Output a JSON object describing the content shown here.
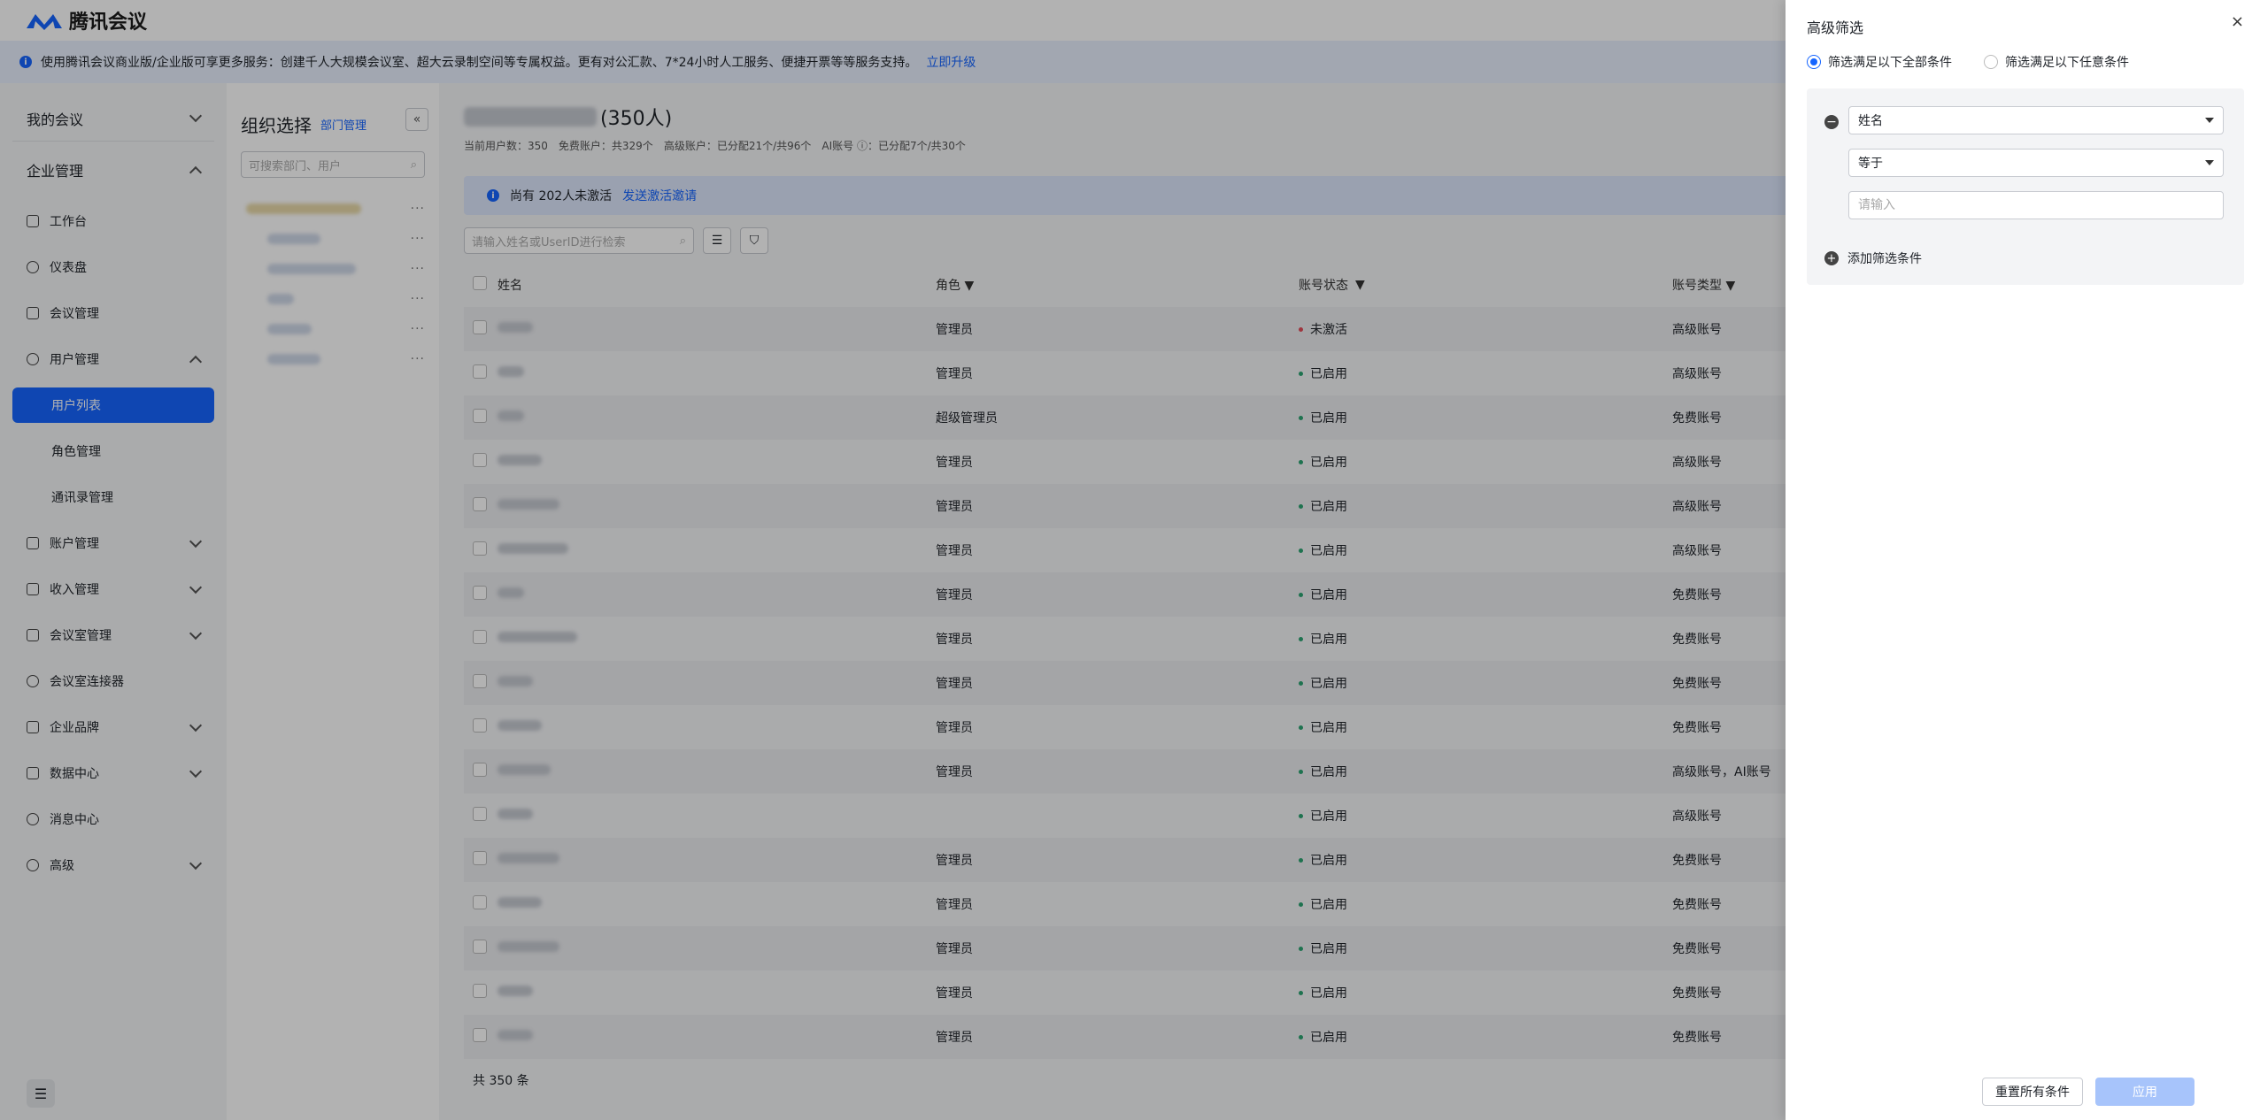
{
  "app": {
    "name": "腾讯会议"
  },
  "banner": {
    "text": "使用腾讯会议商业版/企业版可享更多服务：创建千人大规模会议室、超大云录制空间等专属权益。更有对公汇款、7*24小时人工服务、便捷开票等等服务支持。",
    "link": "立即升级"
  },
  "sidebar": {
    "sections": [
      "我的会议",
      "企业管理"
    ],
    "items": [
      {
        "label": "工作台"
      },
      {
        "label": "仪表盘"
      },
      {
        "label": "会议管理"
      },
      {
        "label": "用户管理"
      },
      {
        "label": "用户列表"
      },
      {
        "label": "角色管理"
      },
      {
        "label": "通讯录管理"
      },
      {
        "label": "账户管理"
      },
      {
        "label": "收入管理"
      },
      {
        "label": "会议室管理"
      },
      {
        "label": "会议室连接器"
      },
      {
        "label": "企业品牌"
      },
      {
        "label": "数据中心"
      },
      {
        "label": "消息中心"
      },
      {
        "label": "高级"
      }
    ]
  },
  "org": {
    "title": "组织选择",
    "manage": "部门管理",
    "search_placeholder": "可搜索部门、用户"
  },
  "main": {
    "count_label": "(350人)",
    "stats": [
      "当前用户数：350",
      "免费账户：共329个",
      "高级账户：已分配21个/共96个",
      "AI账号 ⓘ：已分配7个/共30个"
    ],
    "notice": "尚有 202人未激活",
    "notice_link": "发送激活邀请",
    "search_placeholder": "请输入姓名或UserID进行检索",
    "columns": [
      "姓名",
      "角色",
      "账号状态",
      "账号类型"
    ],
    "rows": [
      {
        "role": "管理员",
        "status": "未激活",
        "type": "高级账号"
      },
      {
        "role": "管理员",
        "status": "已启用",
        "type": "高级账号"
      },
      {
        "role": "超级管理员",
        "status": "已启用",
        "type": "免费账号"
      },
      {
        "role": "管理员",
        "status": "已启用",
        "type": "高级账号"
      },
      {
        "role": "管理员",
        "status": "已启用",
        "type": "高级账号"
      },
      {
        "role": "管理员",
        "status": "已启用",
        "type": "高级账号"
      },
      {
        "role": "管理员",
        "status": "已启用",
        "type": "免费账号"
      },
      {
        "role": "管理员",
        "status": "已启用",
        "type": "免费账号"
      },
      {
        "role": "管理员",
        "status": "已启用",
        "type": "免费账号"
      },
      {
        "role": "管理员",
        "status": "已启用",
        "type": "免费账号"
      },
      {
        "role": "管理员",
        "status": "已启用",
        "type": "高级账号，AI账号"
      },
      {
        "role": "",
        "status": "已启用",
        "type": "高级账号"
      },
      {
        "role": "管理员",
        "status": "已启用",
        "type": "免费账号"
      },
      {
        "role": "管理员",
        "status": "已启用",
        "type": "免费账号"
      },
      {
        "role": "管理员",
        "status": "已启用",
        "type": "免费账号"
      },
      {
        "role": "管理员",
        "status": "已启用",
        "type": "免费账号"
      },
      {
        "role": "管理员",
        "status": "已启用",
        "type": "免费账号"
      }
    ],
    "footer": "共 350 条",
    "colors": {
      "active": "#2ba471",
      "inactive": "#e34d59"
    }
  },
  "drawer": {
    "title": "高级筛选",
    "close": "×",
    "radio_all": "筛选满足以下全部条件",
    "radio_any": "筛选满足以下任意条件",
    "field_select": "姓名",
    "operator_select": "等于",
    "value_placeholder": "请输入",
    "add_condition": "添加筛选条件",
    "reset_label": "重置所有条件",
    "apply_label": "应用"
  }
}
